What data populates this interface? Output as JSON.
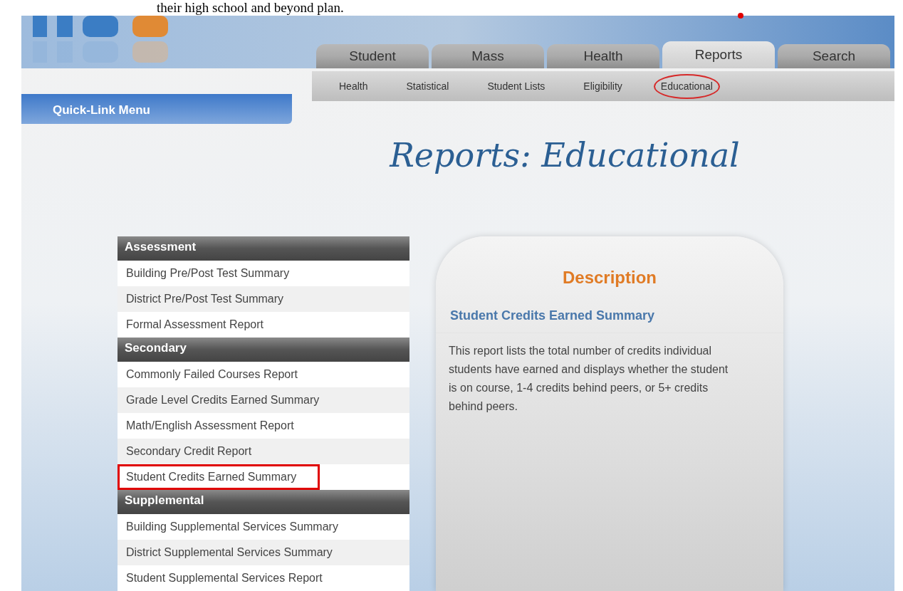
{
  "document_text": "their high school and beyond plan.",
  "tabs": [
    {
      "label": "Student",
      "selected": false
    },
    {
      "label": "Mass",
      "selected": false
    },
    {
      "label": "Health",
      "selected": false
    },
    {
      "label": "Reports",
      "selected": true
    },
    {
      "label": "Search",
      "selected": false
    }
  ],
  "subtabs": [
    {
      "label": "Health",
      "highlighted": false
    },
    {
      "label": "Statistical",
      "highlighted": false
    },
    {
      "label": "Student Lists",
      "highlighted": false
    },
    {
      "label": "Eligibility",
      "highlighted": false
    },
    {
      "label": "Educational",
      "highlighted": true
    }
  ],
  "quick_link_menu": "Quick-Link Menu",
  "page_title": "Reports: Educational",
  "report_groups": [
    {
      "title": "Assessment",
      "items": [
        {
          "label": "Building Pre/Post Test Summary",
          "highlighted": false
        },
        {
          "label": "District Pre/Post Test Summary",
          "highlighted": false
        },
        {
          "label": "Formal Assessment Report",
          "highlighted": false
        }
      ]
    },
    {
      "title": "Secondary",
      "items": [
        {
          "label": "Commonly Failed Courses Report",
          "highlighted": false
        },
        {
          "label": "Grade Level Credits Earned Summary",
          "highlighted": false
        },
        {
          "label": "Math/English Assessment Report",
          "highlighted": false
        },
        {
          "label": "Secondary Credit Report",
          "highlighted": false
        },
        {
          "label": "Student Credits Earned Summary",
          "highlighted": true
        }
      ]
    },
    {
      "title": "Supplemental",
      "items": [
        {
          "label": "Building Supplemental Services Summary",
          "highlighted": false
        },
        {
          "label": "District Supplemental Services Summary",
          "highlighted": false
        },
        {
          "label": "Student Supplemental Services Report",
          "highlighted": false
        }
      ]
    }
  ],
  "description": {
    "heading": "Description",
    "report_name": "Student Credits Earned Summary",
    "text": "This report lists the total number of credits individual students have earned and displays whether the student is on course, 1-4 credits behind peers, or 5+ credits behind peers."
  }
}
